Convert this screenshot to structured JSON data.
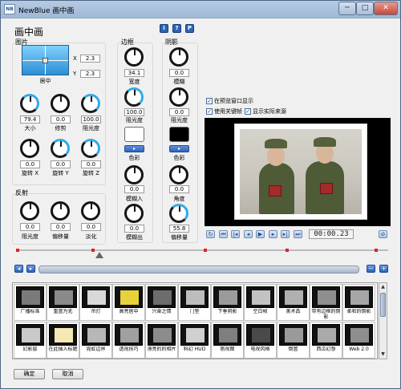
{
  "window": {
    "title": "NewBlue 画中画",
    "app_icon": "NB",
    "controls": {
      "minimize": "─",
      "maximize": "□",
      "close": "✕"
    }
  },
  "heading": "画中画",
  "info_buttons": [
    "i",
    "?",
    "P"
  ],
  "picture": {
    "group_label": "图片",
    "position_label": "居中",
    "x_label": "X",
    "x_value": "2.3",
    "y_label": "Y",
    "y_value": "2.3",
    "knobs": [
      {
        "label": "大小",
        "value": "79.4"
      },
      {
        "label": "修剪",
        "value": "0.0"
      },
      {
        "label": "阻光度",
        "value": "100.0"
      },
      {
        "label": "旋转 X",
        "value": "0.0"
      },
      {
        "label": "旋转 Y",
        "value": "0.0"
      },
      {
        "label": "旋转 Z",
        "value": "0.0"
      }
    ]
  },
  "reflection": {
    "group_label": "反射",
    "knobs": [
      {
        "label": "阻光度",
        "value": "0.0"
      },
      {
        "label": "偏移量",
        "value": "0.0"
      },
      {
        "label": "淡化",
        "value": "0.0"
      }
    ]
  },
  "border": {
    "group_label": "边框",
    "knobs": [
      {
        "label": "宽度",
        "value": "34.1"
      },
      {
        "label": "阻光度",
        "value": "100.0"
      },
      {
        "label": "模糊入",
        "value": "0.0"
      },
      {
        "label": "模糊出",
        "value": "0.0"
      }
    ],
    "color_label": "色彩",
    "color": "#ffffff"
  },
  "shadow": {
    "group_label": "阴影",
    "knobs": [
      {
        "label": "模糊",
        "value": "0.0"
      },
      {
        "label": "阻光度",
        "value": "0.0"
      },
      {
        "label": "角度",
        "value": "0.0"
      },
      {
        "label": "偏移量",
        "value": "55.8"
      }
    ],
    "color_label": "色彩",
    "color": "#000000"
  },
  "options": [
    {
      "label": "在预览窗口显示",
      "checked": true
    },
    {
      "label": "使用关键帧",
      "checked": true
    },
    {
      "label": "显示实际来源",
      "checked": true
    }
  ],
  "playback": {
    "buttons": [
      "loop-icon",
      "go-start-icon",
      "prev-key-icon",
      "step-back-icon",
      "play-icon",
      "step-forward-icon",
      "next-key-icon",
      "go-end-icon",
      "record-icon"
    ],
    "glyphs": [
      "↻",
      "⏮",
      "|◂",
      "◂",
      "▶",
      "▸",
      "▸|",
      "⏭",
      "■"
    ],
    "timecode": "00:00.23",
    "settings_glyph": "⊘"
  },
  "timeline": {
    "prev": "◂",
    "next": "▸",
    "minus": "−",
    "plus": "+"
  },
  "presets": [
    {
      "label": "广播标准",
      "thumb": "#7a7a7a"
    },
    {
      "label": "重置为无",
      "thumb": "#8a8a8a"
    },
    {
      "label": "吊灯",
      "thumb": "#d8d8d8"
    },
    {
      "label": "高亮居中",
      "thumb": "#e6d23a"
    },
    {
      "label": "兴奋之情",
      "thumb": "#6d6d6d"
    },
    {
      "label": "门垫",
      "thumb": "#bdbdbd"
    },
    {
      "label": "下垂阴影",
      "thumb": "#9b9b9b"
    },
    {
      "label": "空白帧",
      "thumb": "#c2c2c2"
    },
    {
      "label": "美术品",
      "thumb": "#b0b0b0"
    },
    {
      "label": "带有边框的倒影",
      "thumb": "#8f8f8f"
    },
    {
      "label": "柔和的倒影",
      "thumb": "#a6a6a6"
    },
    {
      "label": "幻影层",
      "thumb": "#c9c9c9"
    },
    {
      "label": "在此插入标题",
      "thumb": "#f5e8b4"
    },
    {
      "label": "霓虹边界",
      "thumb": "#b7b7b7"
    },
    {
      "label": "透视技巧",
      "thumb": "#a0a0a0"
    },
    {
      "label": "漂亮的的相片",
      "thumb": "#8c8c8c"
    },
    {
      "label": "科幻 HUD",
      "thumb": "#d0d0d0"
    },
    {
      "label": "剔视图",
      "thumb": "#7f7f7f"
    },
    {
      "label": "电视风格",
      "thumb": "#4a4a4a"
    },
    {
      "label": "倒置",
      "thumb": "#9a9a9a"
    },
    {
      "label": "西瓜幻想",
      "thumb": "#aaaaaa"
    },
    {
      "label": "Web 2.0",
      "thumb": "#8e8e8e"
    }
  ],
  "footer": {
    "ok": "确定",
    "cancel": "取消"
  }
}
